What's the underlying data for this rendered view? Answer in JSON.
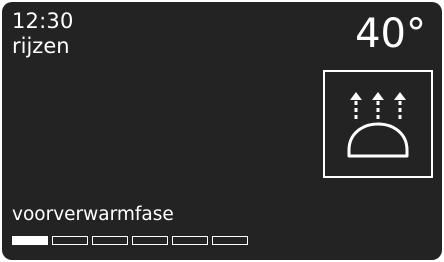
{
  "status": {
    "time": "12:30",
    "mode": "rijzen",
    "temperature": "40°"
  },
  "program": {
    "icon": "proofing-dough-icon"
  },
  "phase": {
    "label": "voorverwarmfase",
    "progress": {
      "filled": 1,
      "total": 6
    }
  },
  "colors": {
    "background": "#232323",
    "foreground": "#ffffff"
  }
}
